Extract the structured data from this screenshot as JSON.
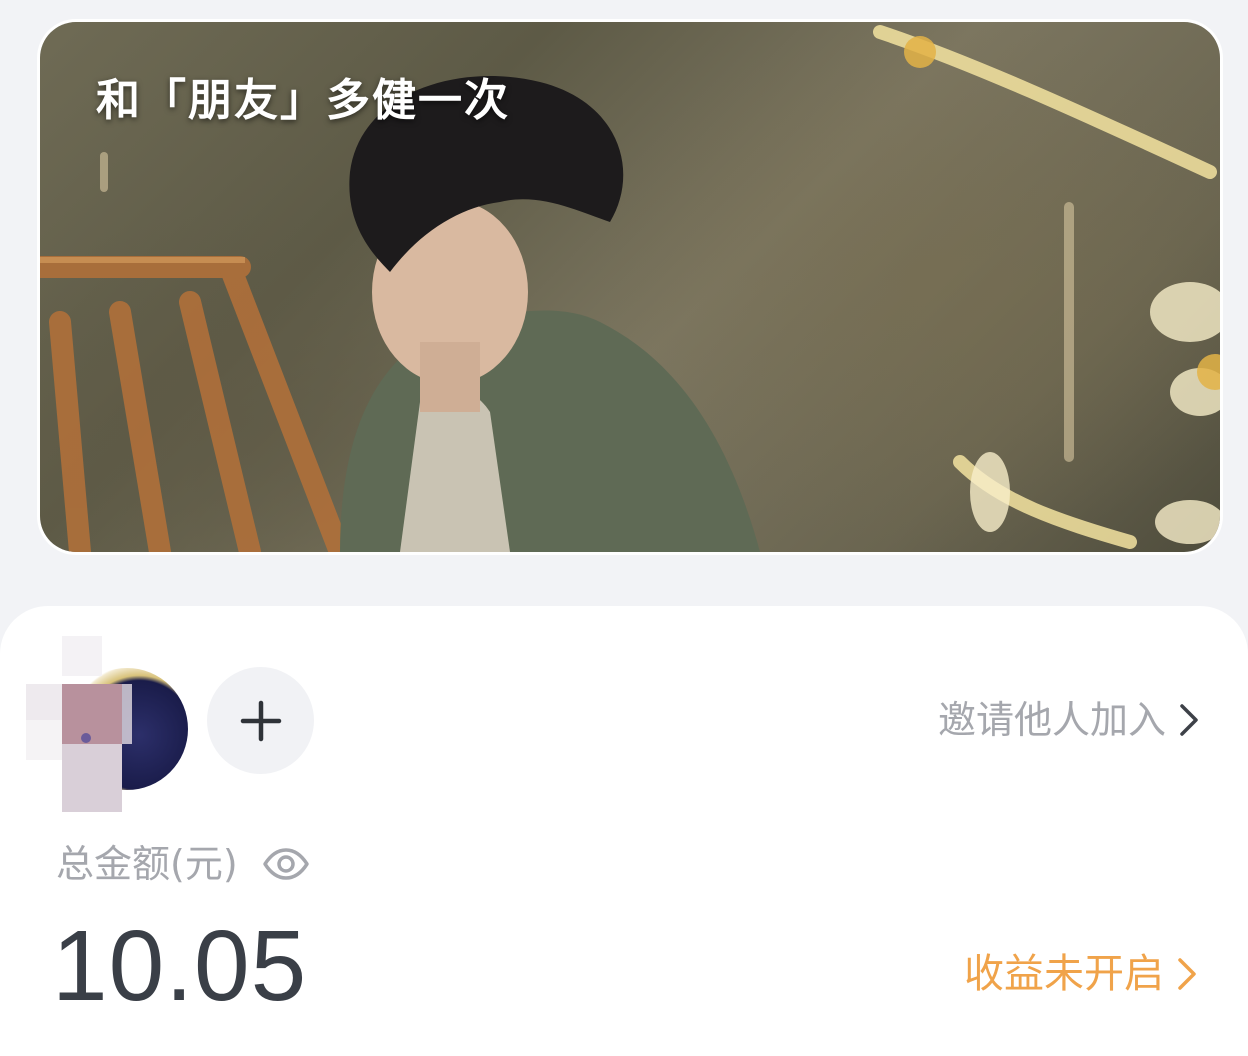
{
  "banner": {
    "title": "和「朋友」多健一次"
  },
  "members": {
    "avatar_icon": "user-avatar",
    "add_icon": "plus-icon",
    "invite_label": "邀请他人加入"
  },
  "summary": {
    "total_label": "总金额(元)",
    "visibility_icon": "eye-icon",
    "total_value": "10.05",
    "earnings_label": "收益未开启"
  },
  "colors": {
    "accent_orange": "#f0a34a",
    "muted_text": "#a5a7ad",
    "amount_text": "#3a3f47",
    "page_bg": "#f2f3f6"
  }
}
